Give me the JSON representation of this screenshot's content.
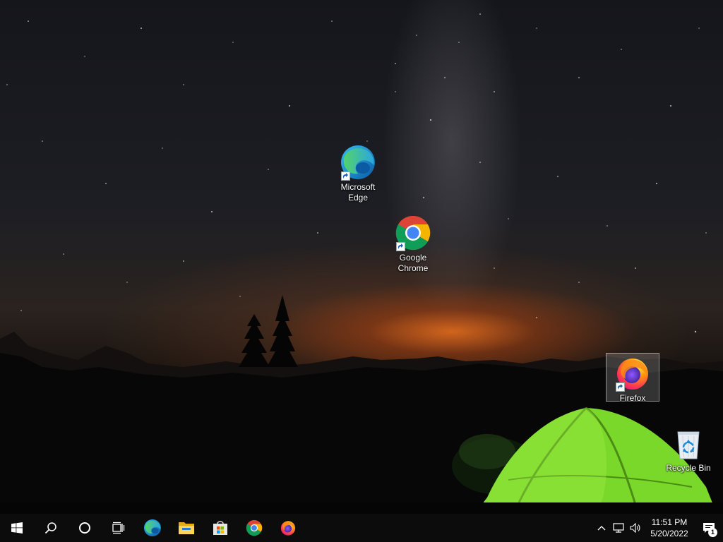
{
  "desktop": {
    "icons": [
      {
        "label": "Microsoft Edge",
        "icon": "edge-icon"
      },
      {
        "label": "Google Chrome",
        "icon": "chrome-icon"
      },
      {
        "label": "Firefox",
        "icon": "firefox-icon",
        "selected": true
      },
      {
        "label": "Recycle Bin",
        "icon": "recycle-bin-icon"
      }
    ]
  },
  "taskbar": {
    "start": "windows-logo-icon",
    "search": "search-icon",
    "cortana": "cortana-icon",
    "task_view": "task-view-icon",
    "pinned": [
      "edge-icon",
      "file-explorer-icon",
      "microsoft-store-icon",
      "chrome-icon",
      "firefox-icon"
    ],
    "tray": {
      "chevron": "chevron-up-icon",
      "network": "network-icon",
      "volume": "volume-icon",
      "time": "11:51 PM",
      "date": "5/20/2022",
      "notification_count": "1"
    }
  },
  "colors": {
    "taskbar_bg": "#0c0c0c",
    "accent": "#0078d7",
    "tent_green": "#7fe02a"
  }
}
